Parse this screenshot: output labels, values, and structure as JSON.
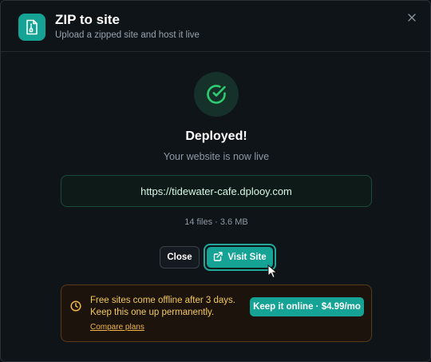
{
  "dialog": {
    "title": "ZIP to site",
    "subtitle": "Upload a zipped site and host it live",
    "app_icon": "zip-file-icon",
    "close_icon": "close-icon"
  },
  "result": {
    "status_icon": "check-circle-icon",
    "heading": "Deployed!",
    "message": "Your website is now live",
    "url": "https://tidewater-cafe.dplooy.com",
    "meta": "14 files · 3.6 MB"
  },
  "actions": {
    "close_label": "Close",
    "visit_label": "Visit Site",
    "visit_icon": "external-link-icon"
  },
  "promo": {
    "icon": "clock-icon",
    "line1": "Free sites come offline after 3 days.",
    "line2": "Keep this one up permanently.",
    "link_label": "Compare plans",
    "cta_label": "Keep it online · $4.99/mo"
  },
  "colors": {
    "accent": "#14a394",
    "success": "#2ecc71",
    "warning_text": "#f2c95c",
    "warning_border": "#5a3a16"
  }
}
